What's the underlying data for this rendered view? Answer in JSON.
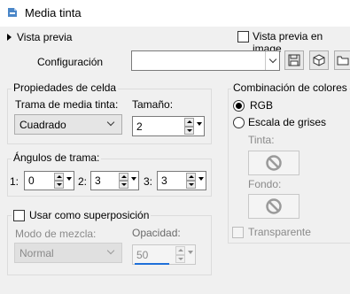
{
  "window": {
    "title": "Media tinta"
  },
  "preview": {
    "toggle_label": "Vista previa",
    "checkbox_label": "Vista previa en image"
  },
  "config": {
    "label": "Configuración",
    "value": ""
  },
  "cell": {
    "title": "Propiedades de celda",
    "pattern_label": "Trama de media tinta:",
    "pattern_value": "Cuadrado",
    "size_label": "Tamaño:",
    "size_value": "2"
  },
  "angles": {
    "title": "Ángulos de trama:",
    "items": [
      {
        "label": "1:",
        "value": "0"
      },
      {
        "label": "2:",
        "value": "3"
      },
      {
        "label": "3:",
        "value": "3"
      }
    ]
  },
  "overlay": {
    "checkbox_label": "Usar como superposición",
    "blend_label": "Modo de mezcla:",
    "blend_value": "Normal",
    "opacity_label": "Opacidad:",
    "opacity_value": "50",
    "opacity_fraction": 0.5
  },
  "colors": {
    "title": "Combinación de colores",
    "rgb_label": "RGB",
    "gray_label": "Escala de grises",
    "ink_label": "Tinta:",
    "bg_label": "Fondo:",
    "transparent_label": "Transparente"
  },
  "accent": "#1e6fd9"
}
